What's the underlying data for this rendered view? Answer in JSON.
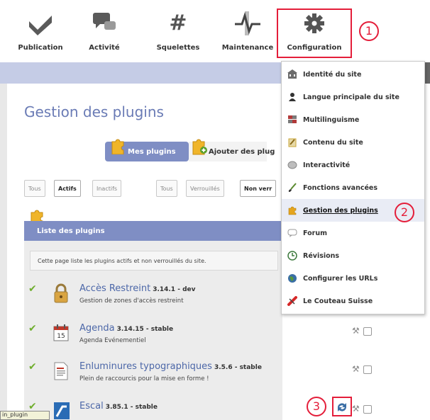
{
  "toolbar": {
    "items": [
      {
        "label": "Publication",
        "icon": "checkmark-icon"
      },
      {
        "label": "Activité",
        "icon": "chat-bubbles-icon"
      },
      {
        "label": "Squelettes",
        "icon": "hash-icon"
      },
      {
        "label": "Maintenance",
        "icon": "pulse-icon"
      },
      {
        "label": "Configuration",
        "icon": "gear-icon"
      }
    ],
    "hash_symbol": "#"
  },
  "page": {
    "title": "Gestion des plugins",
    "tabs": {
      "active": "Mes plugins",
      "add": "Ajouter des plug"
    },
    "filters_left": [
      "Tous",
      "Actifs",
      "Inactifs"
    ],
    "filters_right": [
      "Tous",
      "Verrouillés",
      "Non verr"
    ],
    "list_header": "Liste des plugins",
    "list_description": "Cette page liste les plugins actifs et non verrouillés du site."
  },
  "plugins": [
    {
      "name": "Accès Restreint",
      "version": "3.14.1 - dev",
      "description": "Gestion de zones d'accès restreint",
      "icon": "padlock-icon"
    },
    {
      "name": "Agenda",
      "version": "3.14.15 - stable",
      "description": "Agenda Evénementiel",
      "icon": "calendar-icon",
      "calendar_day": "15"
    },
    {
      "name": "Enluminures typographiques",
      "version": "3.5.6 - stable",
      "description": "Plein de raccourcis pour la mise en forme !",
      "icon": "document-icon"
    },
    {
      "name": "Escal",
      "version": "3.85.1 - stable",
      "description": "",
      "icon": "escal-logo-icon"
    }
  ],
  "menu": {
    "items": [
      {
        "label": "Identité du site",
        "icon": "building-icon",
        "color": "#6b6b6b"
      },
      {
        "label": "Langue principale du site",
        "icon": "person-icon",
        "color": "#333333"
      },
      {
        "label": "Multilinguisme",
        "icon": "flags-icon",
        "color": "#b23a3a"
      },
      {
        "label": "Contenu du site",
        "icon": "content-icon",
        "color": "#c9a63a"
      },
      {
        "label": "Interactivité",
        "icon": "interactivity-icon",
        "color": "#9a9a9a"
      },
      {
        "label": "Fonctions avancées",
        "icon": "brush-icon",
        "color": "#5a8a2e"
      },
      {
        "label": "Gestion des plugins",
        "icon": "puzzle-icon",
        "color": "#e5a51f",
        "active": true
      },
      {
        "label": "Forum",
        "icon": "speech-icon",
        "color": "#9a9a9a"
      },
      {
        "label": "Révisions",
        "icon": "revision-icon",
        "color": "#3d7a3d"
      },
      {
        "label": "Configurer les URLs",
        "icon": "globe-icon",
        "color": "#3a6ea5"
      },
      {
        "label": "Le Couteau Suisse",
        "icon": "swiss-knife-icon",
        "color": "#d62828"
      }
    ]
  },
  "annotations": {
    "badge1": "1",
    "badge2": "2",
    "badge3": "3",
    "color": "#e41e3a"
  },
  "tooltip": "in_plugin",
  "colors": {
    "accent": "#7f8ec4",
    "title": "#6a7bb5",
    "check": "#6fae2e",
    "link": "#4c67a8"
  }
}
